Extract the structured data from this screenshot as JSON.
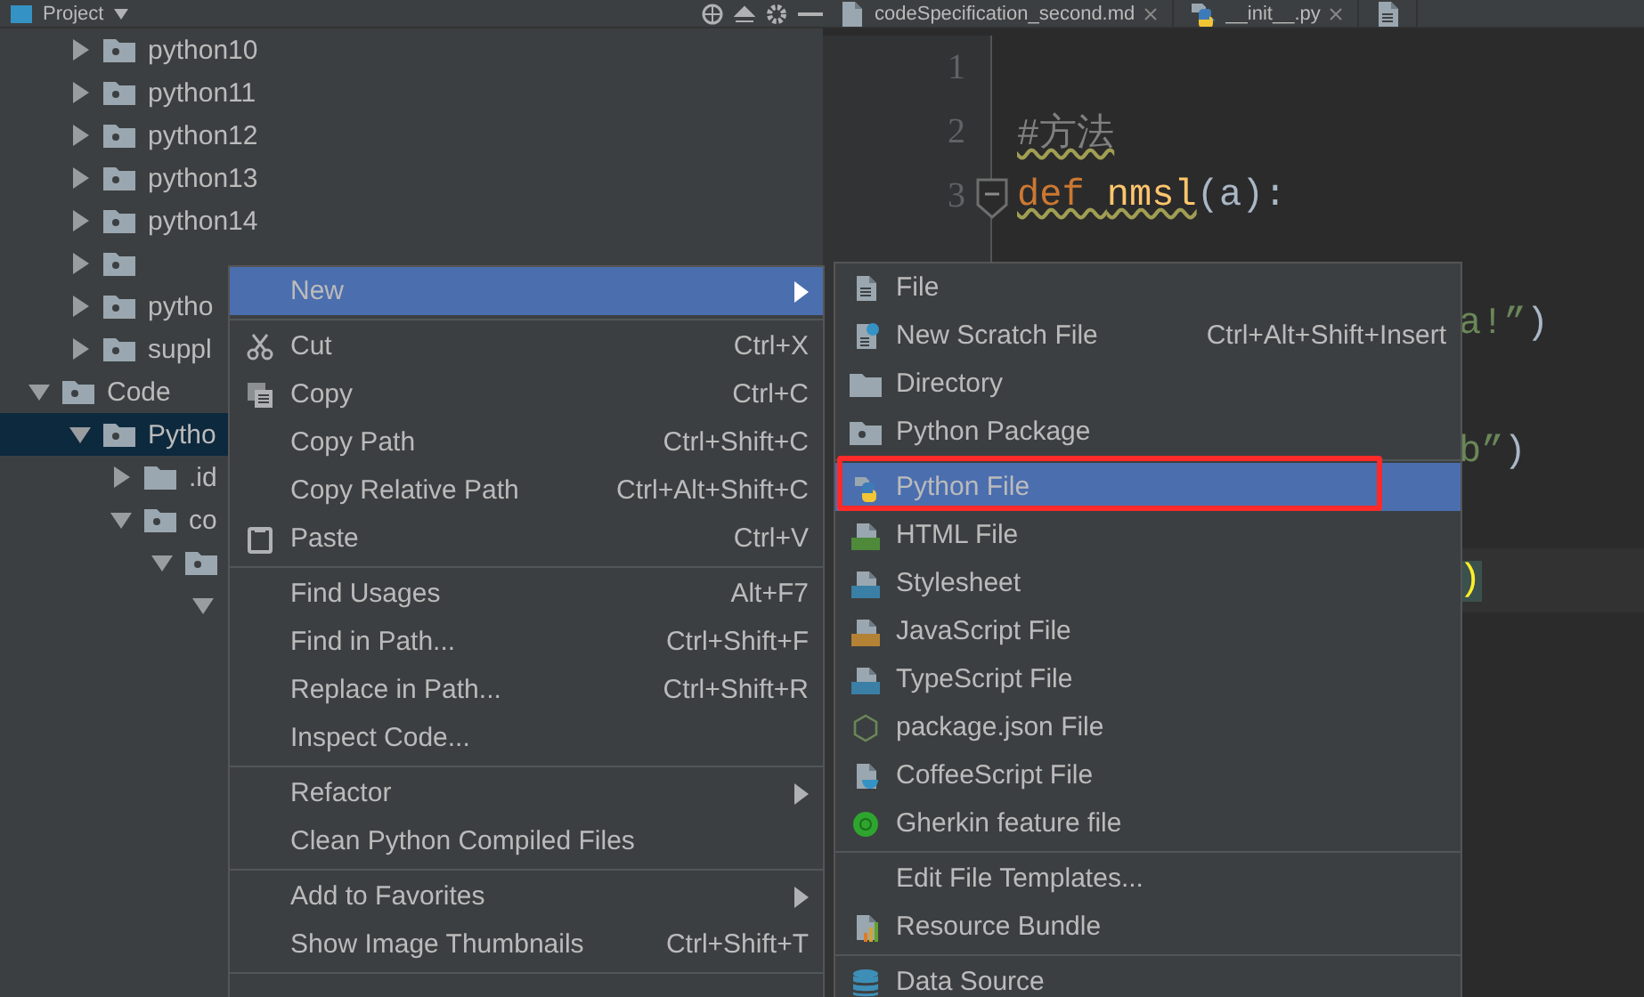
{
  "panel": {
    "title": "Project"
  },
  "tree": [
    {
      "kind": "hidden",
      "children": [
        {
          "kind": "module",
          "label": "python10",
          "expanded": false,
          "selected": false
        },
        {
          "kind": "module",
          "label": "python11",
          "expanded": false,
          "selected": false
        },
        {
          "kind": "module",
          "label": "python12",
          "expanded": false,
          "selected": false
        },
        {
          "kind": "module",
          "label": "python13",
          "expanded": false,
          "selected": false
        },
        {
          "kind": "module",
          "label": "python14",
          "expanded": false,
          "selected": false
        },
        {
          "kind": "module",
          "expanded": false,
          "selected": false
        },
        {
          "kind": "module",
          "label": "pytho",
          "expanded": false,
          "selected": false
        },
        {
          "kind": "module",
          "label": "suppl",
          "expanded": false,
          "selected": false
        }
      ]
    },
    {
      "kind": "module",
      "label": "Code",
      "expanded": true,
      "selected": false,
      "children": [
        {
          "kind": "module",
          "label": "Pytho",
          "expanded": true,
          "selected": true,
          "children": [
            {
              "kind": "folder",
              "label": ".id",
              "expanded": false,
              "selected": false
            },
            {
              "kind": "module",
              "label": "co",
              "expanded": true,
              "selected": false,
              "children": [
                {
                  "kind": "module",
                  "expanded": true,
                  "selected": false,
                  "children": [
                    {
                      "expanded": true,
                      "selected": false
                    }
                  ]
                }
              ]
            }
          ]
        }
      ]
    }
  ],
  "tabs": [
    {
      "kind": "markdown",
      "label": "codeSpecification_second.md"
    },
    {
      "kind": "python",
      "label": "__init__.py"
    },
    {
      "kind": "file"
    }
  ],
  "editor": {
    "lines": [
      {
        "kind": "code",
        "number": "1"
      },
      {
        "kind": "code",
        "number": "2",
        "tokens": [
          {
            "kind": "comment",
            "text": "#方法"
          }
        ]
      },
      {
        "kind": "code",
        "number": "3",
        "fold": true,
        "tokens": [
          {
            "kind": "keyword",
            "text": "def "
          },
          {
            "kind": "function",
            "text": "nmsl"
          },
          {
            "kind": "plain",
            "text": "(a):"
          }
        ]
      },
      {
        "kind": "code"
      },
      {
        "kind": "tail",
        "tokens": [
          {
            "kind": "string",
            "text": "a!”"
          },
          {
            "kind": "plain",
            "text": ")"
          }
        ]
      },
      {
        "kind": "tail"
      },
      {
        "kind": "tail",
        "tokens": [
          {
            "kind": "string",
            "text": "b”"
          },
          {
            "kind": "plain",
            "text": ")"
          }
        ]
      },
      {
        "kind": "tail"
      },
      {
        "kind": "tail",
        "current": true,
        "tokens": [
          {
            "kind": "brace",
            "text": ")"
          }
        ]
      }
    ]
  },
  "menus": [
    {
      "items": [
        {
          "kind": "plain",
          "label": "New",
          "submenu": true,
          "selected": true
        },
        {
          "kind": "separator"
        },
        {
          "kind": "scissors",
          "label": "Cut",
          "shortcut": "Ctrl+X",
          "selected": false
        },
        {
          "kind": "copy",
          "label": "Copy",
          "shortcut": "Ctrl+C",
          "selected": false
        },
        {
          "kind": "plain",
          "label": "Copy Path",
          "shortcut": "Ctrl+Shift+C",
          "selected": false
        },
        {
          "kind": "plain",
          "label": "Copy Relative Path",
          "shortcut": "Ctrl+Alt+Shift+C",
          "selected": false
        },
        {
          "kind": "clipboard",
          "label": "Paste",
          "shortcut": "Ctrl+V",
          "selected": false
        },
        {
          "kind": "separator"
        },
        {
          "kind": "plain",
          "label": "Find Usages",
          "shortcut": "Alt+F7",
          "selected": false
        },
        {
          "kind": "plain",
          "label": "Find in Path...",
          "shortcut": "Ctrl+Shift+F",
          "selected": false
        },
        {
          "kind": "plain",
          "label": "Replace in Path...",
          "shortcut": "Ctrl+Shift+R",
          "selected": false
        },
        {
          "kind": "plain",
          "label": "Inspect Code...",
          "selected": false
        },
        {
          "kind": "separator"
        },
        {
          "kind": "plain",
          "label": "Refactor",
          "submenu": true,
          "selected": false
        },
        {
          "kind": "plain",
          "label": "Clean Python Compiled Files",
          "selected": false
        },
        {
          "kind": "separator"
        },
        {
          "kind": "plain",
          "label": "Add to Favorites",
          "submenu": true,
          "selected": false
        },
        {
          "kind": "plain",
          "label": "Show Image Thumbnails",
          "shortcut": "Ctrl+Shift+T",
          "selected": false
        },
        {
          "kind": "separator"
        }
      ]
    },
    {
      "items": [
        {
          "kind": "file",
          "label": "File",
          "selected": false
        },
        {
          "kind": "scratch",
          "label": "New Scratch File",
          "shortcut": "Ctrl+Alt+Shift+Insert",
          "selected": false
        },
        {
          "kind": "folder",
          "label": "Directory",
          "selected": false
        },
        {
          "kind": "package",
          "label": "Python Package",
          "selected": false
        },
        {
          "kind": "separator"
        },
        {
          "kind": "python",
          "label": "Python File",
          "selected": true
        },
        {
          "kind": "html",
          "label": "HTML File",
          "selected": false
        },
        {
          "kind": "css",
          "label": "Stylesheet",
          "selected": false
        },
        {
          "kind": "js",
          "label": "JavaScript File",
          "selected": false
        },
        {
          "kind": "ts",
          "label": "TypeScript File",
          "selected": false
        },
        {
          "kind": "node",
          "label": "package.json File",
          "selected": false
        },
        {
          "kind": "coffee",
          "label": "CoffeeScript File",
          "selected": false
        },
        {
          "kind": "gherkin",
          "label": "Gherkin feature file",
          "selected": false
        },
        {
          "kind": "separator"
        },
        {
          "kind": "plain",
          "label": "Edit File Templates...",
          "selected": false
        },
        {
          "kind": "bundle",
          "label": "Resource Bundle",
          "selected": false
        },
        {
          "kind": "separator"
        },
        {
          "kind": "database",
          "label": "Data Source",
          "selected": false
        }
      ]
    }
  ]
}
